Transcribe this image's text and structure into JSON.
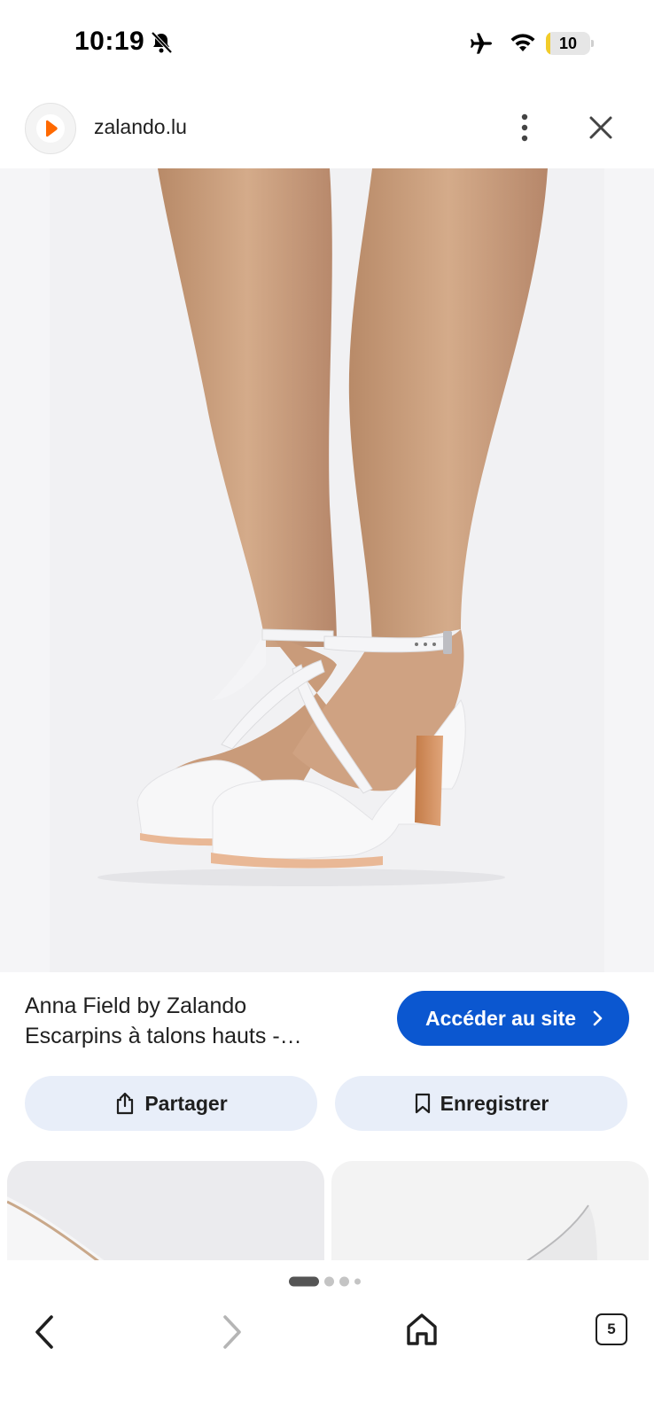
{
  "status_bar": {
    "time": "10:19",
    "battery_level": "10",
    "battery_fraction": 0.1,
    "battery_color": "#f2cc2a",
    "icons": [
      "bell-slash-icon",
      "airplane-icon",
      "wifi-icon",
      "battery-icon"
    ]
  },
  "top_bar": {
    "domain": "zalando.lu",
    "favicon_color": "#ff6900",
    "icons": [
      "more-vert-icon",
      "close-icon"
    ]
  },
  "product": {
    "title_line1": "Anna Field by Zalando",
    "title_line2": "Escarpins à talons hauts -…",
    "visit_label": "Accéder au site",
    "share_label": "Partager",
    "save_label": "Enregistrer"
  },
  "bottom_nav": {
    "tab_count": "5",
    "page_indicator": {
      "count": 4,
      "active": 0
    },
    "icons": [
      "back-icon",
      "forward-icon",
      "home-icon",
      "tabs-icon"
    ]
  },
  "colors": {
    "accent": "#0b57d0",
    "pill_bg": "#e8eef9",
    "image_bg": "#f1f1f3"
  }
}
